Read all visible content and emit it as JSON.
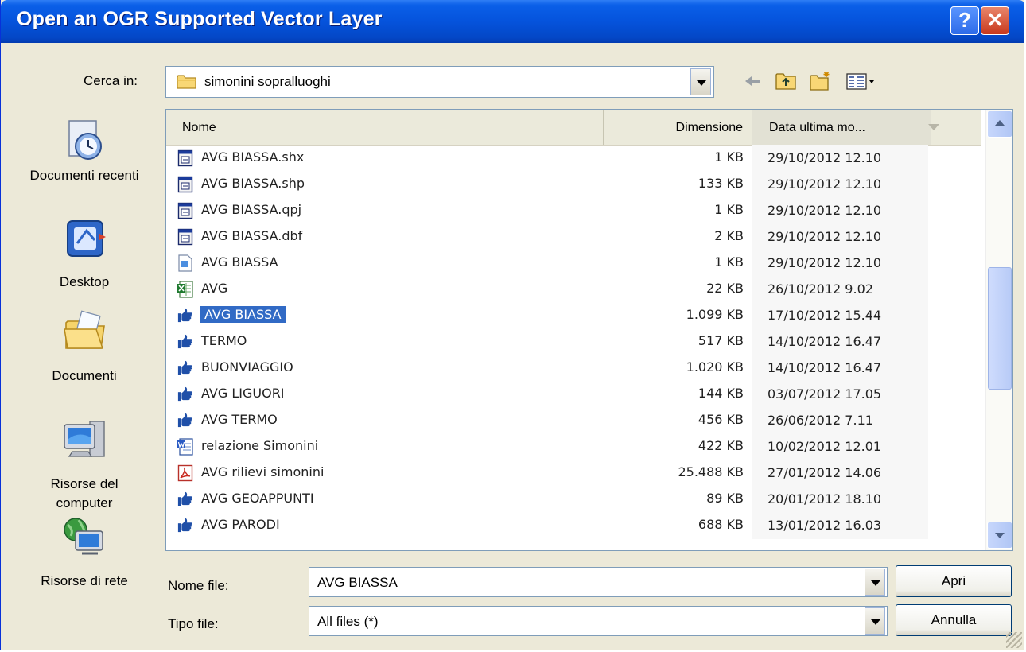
{
  "window": {
    "title": "Open an OGR Supported Vector Layer",
    "help_label": "?",
    "close_label": "✕"
  },
  "lookin": {
    "label": "Cerca in:",
    "value": "simonini sopralluoghi"
  },
  "places": [
    {
      "label": "Documenti recenti",
      "icon": "recent-documents-icon"
    },
    {
      "label": "Desktop",
      "icon": "desktop-icon"
    },
    {
      "label": "Documenti",
      "icon": "documents-folder-icon"
    },
    {
      "label": "Risorse del computer",
      "icon": "my-computer-icon"
    },
    {
      "label": "Risorse di rete",
      "icon": "network-icon"
    }
  ],
  "columns": {
    "name": "Nome",
    "size": "Dimensione",
    "date": "Data ultima mo..."
  },
  "files": [
    {
      "name": "AVG BIASSA.shx",
      "size": "1 KB",
      "date": "29/10/2012 12.10",
      "icon": "generic-file-icon"
    },
    {
      "name": "AVG BIASSA.shp",
      "size": "133 KB",
      "date": "29/10/2012 12.10",
      "icon": "generic-file-icon"
    },
    {
      "name": "AVG BIASSA.qpj",
      "size": "1 KB",
      "date": "29/10/2012 12.10",
      "icon": "generic-file-icon"
    },
    {
      "name": "AVG BIASSA.dbf",
      "size": "2 KB",
      "date": "29/10/2012 12.10",
      "icon": "generic-file-icon"
    },
    {
      "name": "AVG BIASSA",
      "size": "1 KB",
      "date": "29/10/2012 12.10",
      "icon": "text-file-icon"
    },
    {
      "name": "AVG",
      "size": "22 KB",
      "date": "26/10/2012 9.02",
      "icon": "excel-file-icon"
    },
    {
      "name": "AVG BIASSA",
      "size": "1.099 KB",
      "date": "17/10/2012 15.44",
      "icon": "thumbs-up-file-icon",
      "selected": true
    },
    {
      "name": "TERMO",
      "size": "517 KB",
      "date": "14/10/2012 16.47",
      "icon": "thumbs-up-file-icon"
    },
    {
      "name": "BUONVIAGGIO",
      "size": "1.020 KB",
      "date": "14/10/2012 16.47",
      "icon": "thumbs-up-file-icon"
    },
    {
      "name": "AVG LIGUORI",
      "size": "144 KB",
      "date": "03/07/2012 17.05",
      "icon": "thumbs-up-file-icon"
    },
    {
      "name": "AVG TERMO",
      "size": "456 KB",
      "date": "26/06/2012 7.11",
      "icon": "thumbs-up-file-icon"
    },
    {
      "name": "relazione Simonini",
      "size": "422 KB",
      "date": "10/02/2012 12.01",
      "icon": "word-file-icon"
    },
    {
      "name": "AVG rilievi simonini",
      "size": "25.488 KB",
      "date": "27/01/2012 14.06",
      "icon": "pdf-file-icon"
    },
    {
      "name": "AVG GEOAPPUNTI",
      "size": "89 KB",
      "date": "20/01/2012 18.10",
      "icon": "thumbs-up-file-icon"
    },
    {
      "name": "AVG PARODI",
      "size": "688 KB",
      "date": "13/01/2012 16.03",
      "icon": "thumbs-up-file-icon"
    }
  ],
  "filename": {
    "label": "Nome file:",
    "value": "AVG BIASSA"
  },
  "filetype": {
    "label": "Tipo file:",
    "value": "All files (*)"
  },
  "buttons": {
    "open": "Apri",
    "cancel": "Annulla"
  },
  "colors": {
    "titlebar": "#0553dc",
    "selection": "#316ac5",
    "dialog_bg": "#ece9d8"
  }
}
